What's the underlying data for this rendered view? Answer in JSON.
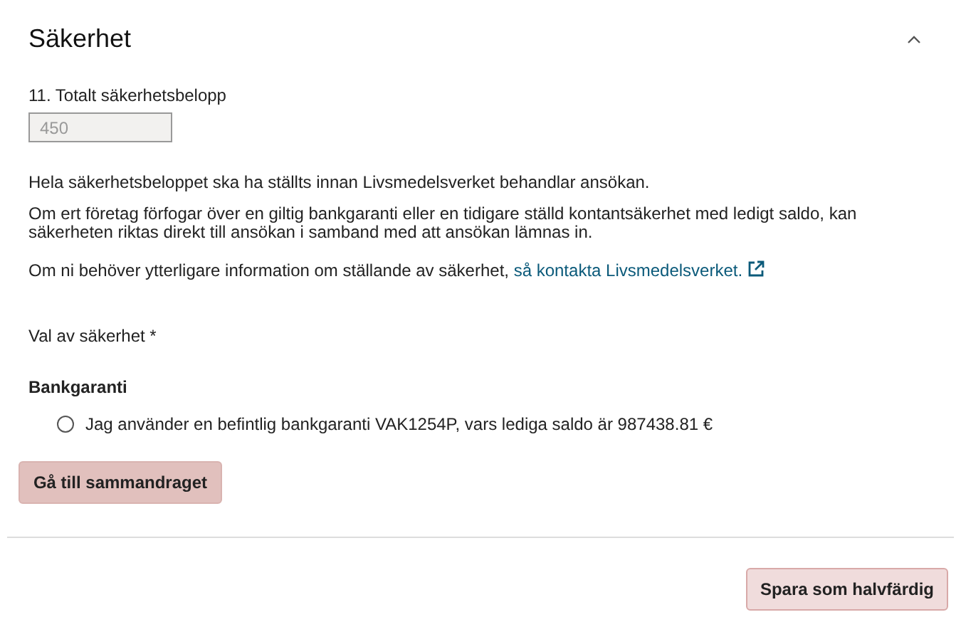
{
  "section": {
    "title": "Säkerhet",
    "expanded": true,
    "amount": {
      "label": "11. Totalt säkerhetsbelopp",
      "value": "450",
      "disabled": true
    },
    "paragraphs": [
      "Hela säkerhetsbeloppet ska ha ställts innan Livsmedelsverket behandlar ansökan.",
      "Om ert företag förfogar över en giltig bankgaranti eller en tidigare ställd kontantsäkerhet med ledigt saldo, kan säkerheten riktas direkt till ansökan i samband med att ansökan lämnas in."
    ],
    "info": {
      "text": "Om ni behöver ytterligare information om ställande av säkerhet, ",
      "link": "så kontakta Livsmedelsverket."
    },
    "choice_label": "Val av säkerhet *",
    "group_title": "Bankgaranti",
    "options": [
      {
        "label": "Jag använder en befintlig bankgaranti VAK1254P, vars lediga saldo är 987438.81 €",
        "selected": false
      }
    ],
    "button": "Gå till sammandraget"
  },
  "footer_button": "Spara som halvfärdig"
}
